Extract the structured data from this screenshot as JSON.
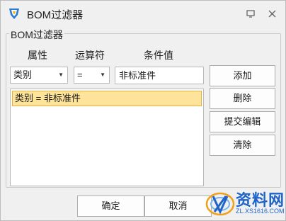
{
  "window": {
    "title": "BOM过滤器"
  },
  "group": {
    "legend": "BOM过滤器"
  },
  "columns": {
    "attribute": "属性",
    "operator": "运算符",
    "condition": "条件值"
  },
  "filter": {
    "attribute_value": "类别",
    "operator_value": "=",
    "condition_value": "非标准件"
  },
  "list": {
    "items": [
      "类别 = 非标准件"
    ]
  },
  "buttons": {
    "add": "添加",
    "delete": "删除",
    "submit_edit": "提交编辑",
    "clear": "清除",
    "ok": "确定",
    "cancel": "取消"
  },
  "watermark": {
    "title": "资料网",
    "url": "ZL.XS1616.COM"
  },
  "colors": {
    "selection": "#fde49a",
    "selection_border": "#e5b13c",
    "watermark": "#1f64c8"
  }
}
